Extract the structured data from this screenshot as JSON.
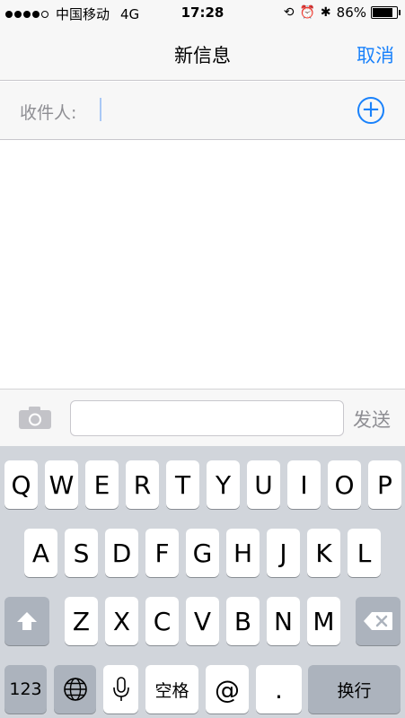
{
  "status_bar": {
    "carrier": "中国移动",
    "network": "4G",
    "time": "17:28",
    "battery_percent": "86%",
    "battery_level": 0.86
  },
  "nav": {
    "title": "新信息",
    "cancel_label": "取消"
  },
  "recipient": {
    "label": "收件人:",
    "value": ""
  },
  "compose": {
    "message_value": "",
    "send_label": "发送"
  },
  "keyboard": {
    "row1": [
      "Q",
      "W",
      "E",
      "R",
      "T",
      "Y",
      "U",
      "I",
      "O",
      "P"
    ],
    "row2": [
      "A",
      "S",
      "D",
      "F",
      "G",
      "H",
      "J",
      "K",
      "L"
    ],
    "row3": [
      "Z",
      "X",
      "C",
      "V",
      "B",
      "N",
      "M"
    ],
    "numbers_label": "123",
    "space_label": "空格",
    "at_label": "@",
    "dot_label": ".",
    "return_label": "换行"
  },
  "colors": {
    "accent": "#1a82fb",
    "keyboard_bg": "#d1d5db",
    "muted": "#8e8e93"
  },
  "icons": {
    "add": "plus-circle-icon",
    "camera": "camera-icon",
    "shift": "shift-icon",
    "backspace": "backspace-icon",
    "globe": "globe-icon",
    "mic": "microphone-icon"
  }
}
